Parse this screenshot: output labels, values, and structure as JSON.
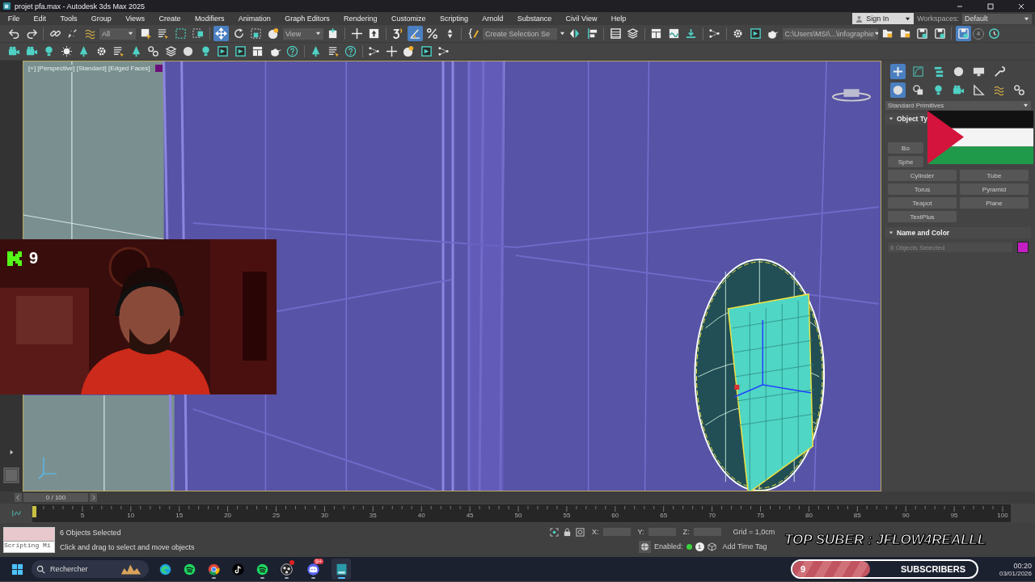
{
  "window": {
    "title": "projet pfa.max - Autodesk 3ds Max 2025"
  },
  "menu": [
    "File",
    "Edit",
    "Tools",
    "Group",
    "Views",
    "Create",
    "Modifiers",
    "Animation",
    "Graph Editors",
    "Rendering",
    "Customize",
    "Scripting",
    "Arnold",
    "Substance",
    "Civil View",
    "Help"
  ],
  "account": {
    "sign_in": "Sign In",
    "workspaces_label": "Workspaces:",
    "workspace": "Default"
  },
  "toolbar": {
    "selection_filter": "All",
    "coordinate_system": "View",
    "named_selection": "Create Selection Se",
    "project_path": "C:\\Users\\MSI\\...\\infographie",
    "backup_count": "4",
    "move_selected": true,
    "angle_snap_on": true,
    "autobackup_on": true
  },
  "viewport": {
    "label": "[+] [Perspective] [Standard] [Edged Faces]"
  },
  "command_panel": {
    "tabs": [
      {
        "selected": true
      },
      {
        "selected": false
      },
      {
        "selected": false
      },
      {
        "selected": false
      },
      {
        "selected": false
      },
      {
        "selected": false
      }
    ],
    "categories": [
      {
        "selected": true
      },
      {
        "selected": false
      },
      {
        "selected": false
      },
      {
        "selected": false
      },
      {
        "selected": false
      },
      {
        "selected": false
      },
      {
        "selected": false
      }
    ],
    "dropdown": "Standard Primitives",
    "object_type": {
      "title": "Object Ty",
      "expanded": true,
      "buttons": [
        "Bo",
        "Sphe",
        "Cylinder",
        "Tube",
        "Torus",
        "Pyramid",
        "Teapot",
        "Plane",
        "TextPlus"
      ]
    },
    "name_and_color": {
      "title": "Name and Color",
      "expanded": true,
      "name": "6 Objects Selected"
    }
  },
  "timeline": {
    "frame": "0 / 100",
    "ticks": [
      "5",
      "10",
      "15",
      "20",
      "25",
      "30",
      "35",
      "40",
      "45",
      "50",
      "55",
      "60",
      "65",
      "70",
      "75",
      "80",
      "85",
      "90",
      "95",
      "100"
    ]
  },
  "status": {
    "listener": "Scripting Mi",
    "selection": "6 Objects Selected",
    "prompt": "Click and drag to select and move objects",
    "x_label": "X:",
    "y_label": "Y:",
    "z_label": "Z:",
    "grid": "Grid = 1,0cm",
    "enabled_label": "Enabled:",
    "enabled": true,
    "time_tag_count": "1",
    "add_time_tag": "Add Time Tag"
  },
  "taskbar": {
    "search_placeholder": "Rechercher",
    "apps": [
      {
        "kind": "edge",
        "running": false
      },
      {
        "kind": "spotify",
        "running": false
      },
      {
        "kind": "chrome",
        "running": true
      },
      {
        "kind": "tiktok",
        "running": false
      },
      {
        "kind": "spotify",
        "running": true
      },
      {
        "kind": "obs",
        "running": true,
        "badge_dot": true
      },
      {
        "kind": "discord",
        "running": true,
        "badge": "9+"
      },
      {
        "kind": "max",
        "running": true
      }
    ],
    "time": "00:20",
    "date": "03/01/2026"
  },
  "overlays": {
    "kick_count": "9",
    "top_sub": "TOP SUBER : JFLOW4REALLL",
    "subscriber_goal": {
      "count": "9",
      "label": "SUBSCRIBERS",
      "level": 0.42
    }
  }
}
